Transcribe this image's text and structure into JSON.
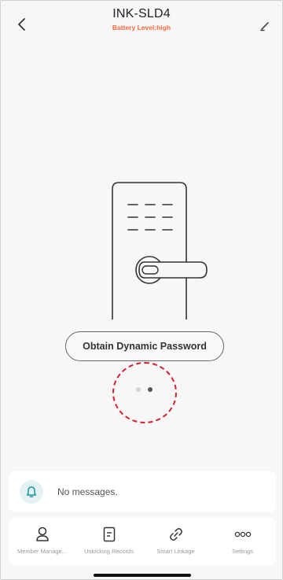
{
  "header": {
    "title": "INK-SLD4",
    "battery_text": "Battery Level:high"
  },
  "icons": {
    "back": "chevron-left-icon",
    "edit": "pencil-icon",
    "bell": "bell-icon",
    "member": "person-icon",
    "records": "document-icon",
    "linkage": "link-icon",
    "settings": "more-dots-icon"
  },
  "main": {
    "obtain_button_label": "Obtain Dynamic Password",
    "pager": {
      "count": 2,
      "active_index": 1
    }
  },
  "messages": {
    "text": "No messages."
  },
  "bottom_nav": {
    "items": [
      {
        "label": "Member Manage..."
      },
      {
        "label": "Unlocking Records"
      },
      {
        "label": "Smart Linkage"
      },
      {
        "label": "Settings"
      }
    ]
  },
  "colors": {
    "battery_text": "#ff6a3d",
    "highlight": "#d41f2e",
    "bell_accent": "#1a9aa6"
  }
}
